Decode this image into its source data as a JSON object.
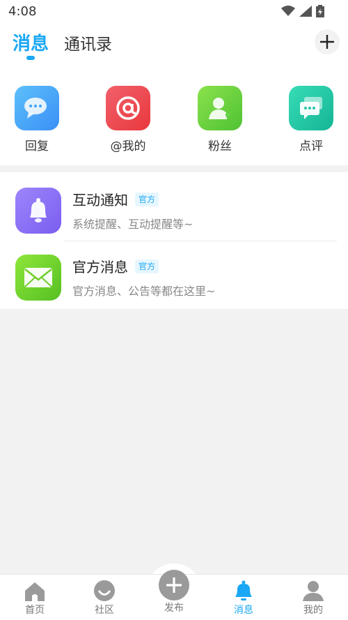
{
  "status_bar": {
    "time": "4:08"
  },
  "header": {
    "tab_messages": "消息",
    "tab_contacts": "通讯录"
  },
  "quick_actions": [
    {
      "label": "回复",
      "icon": "chat-bubble-icon",
      "color": "#3ea3f7"
    },
    {
      "label": "@我的",
      "icon": "at-sign-icon",
      "color": "#f24c4f"
    },
    {
      "label": "粉丝",
      "icon": "fan-user-icon",
      "color": "#6ad14a"
    },
    {
      "label": "点评",
      "icon": "comment-cards-icon",
      "color": "#22c7a5"
    }
  ],
  "messages": [
    {
      "title": "互动通知",
      "badge": "官方",
      "subtitle": "系统提醒、互动提醒等~",
      "icon": "bell-icon",
      "color": "#8a6cf2"
    },
    {
      "title": "官方消息",
      "badge": "官方",
      "subtitle": "官方消息、公告等都在这里~",
      "icon": "envelope-icon",
      "color": "#6fcf2a"
    }
  ],
  "bottom_nav": [
    {
      "label": "首页",
      "icon": "home-icon",
      "active": false
    },
    {
      "label": "社区",
      "icon": "community-icon",
      "active": false
    },
    {
      "label": "发布",
      "icon": "plus-icon",
      "active": false
    },
    {
      "label": "消息",
      "icon": "bell-icon",
      "active": true
    },
    {
      "label": "我的",
      "icon": "user-icon",
      "active": false
    }
  ],
  "colors": {
    "accent": "#1aa7f5",
    "background": "#f2f2f2"
  }
}
